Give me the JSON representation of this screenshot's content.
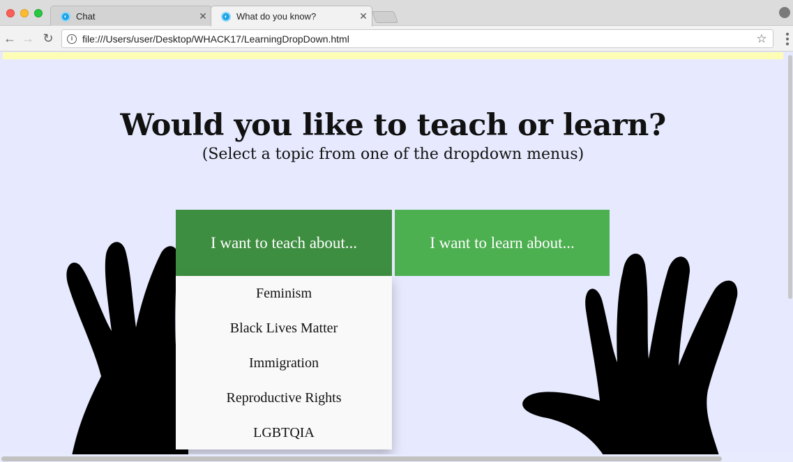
{
  "browser": {
    "tabs": [
      {
        "title": "Chat",
        "active": false
      },
      {
        "title": "What do you know?",
        "active": true
      }
    ],
    "tab_close_glyph": "✕",
    "url": "file:///Users/user/Desktop/WHACK17/LearningDropDown.html",
    "icons": [
      "back-arrow-icon",
      "forward-arrow-icon",
      "reload-icon",
      "info-icon",
      "star-icon",
      "profile-icon",
      "menu-icon"
    ]
  },
  "page": {
    "headline": "Would you like to teach or learn?",
    "subhead": "(Select a topic from one of the dropdown menus)",
    "teach_button": "I want to teach about...",
    "learn_button": "I want to learn about...",
    "teach_menu": [
      "Feminism",
      "Black Lives Matter",
      "Immigration",
      "Reproductive Rights",
      "LGBTQIA"
    ],
    "colors": {
      "background": "#e7eafe",
      "teach_button": "#3e8e41",
      "learn_button": "#4caf50",
      "menu_bg": "#f9f9f9"
    }
  }
}
